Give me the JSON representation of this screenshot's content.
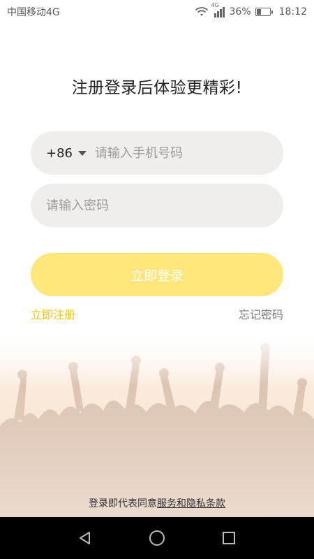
{
  "status_bar": {
    "carrier": "中国移动4G",
    "network": "4G",
    "battery": "36%",
    "battery_level": 0.36,
    "time": "18:12",
    "icons": [
      "wifi-icon",
      "signal-icon",
      "battery-icon"
    ]
  },
  "login": {
    "headline": "注册登录后体验更精彩!",
    "country_code": "+86",
    "phone_placeholder": "请输入手机号码",
    "phone_value": "",
    "password_placeholder": "请输入密码",
    "password_value": "",
    "login_button": "立即登录",
    "register_link": "立即注册",
    "forgot_link": "忘记密码"
  },
  "agreement": {
    "prefix": "登录即代表同意",
    "link": "服务和隐私条款"
  },
  "nav_bar": {
    "icons": [
      "back-icon",
      "home-icon",
      "recents-icon"
    ]
  },
  "colors": {
    "accent": "#fde77b",
    "link_accent": "#f5c400",
    "field_bg": "#efeeea"
  }
}
